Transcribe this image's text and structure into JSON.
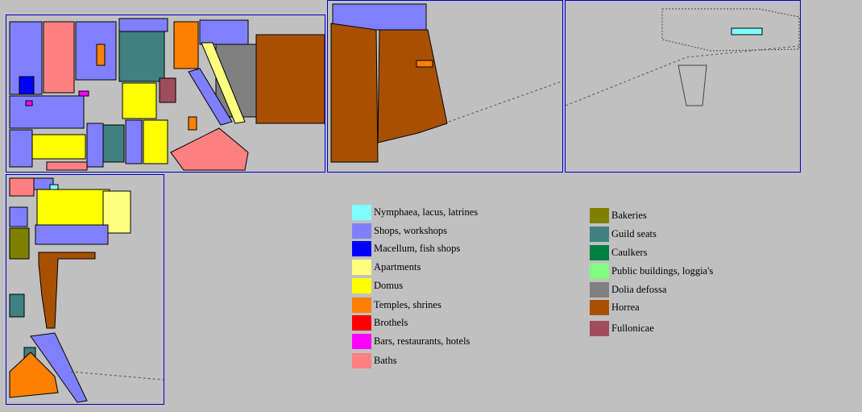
{
  "colors": {
    "nymphaea": "#80ffff",
    "shops": "#8080ff",
    "macellum": "#0000ff",
    "apartments": "#ffff80",
    "domus": "#ffff00",
    "temples": "#ff8000",
    "brothels": "#ff0000",
    "bars": "#ff00ff",
    "baths": "#ff8080",
    "bakeries": "#808000",
    "guild": "#408080",
    "caulkers": "#008040",
    "public": "#80ff80",
    "dolia": "#808080",
    "horrea": "#a85000",
    "fullonicae": "#a04c5c",
    "street": "#c0c0c0",
    "panel_border": "#0000c8"
  },
  "legend": {
    "left": [
      {
        "label": "Nymphaea, lacus, latrines",
        "color": "#80ffff"
      },
      {
        "label": "Shops, workshops",
        "color": "#8080ff"
      },
      {
        "label": "Macellum, fish shops",
        "color": "#0000ff"
      },
      {
        "label": "Apartments",
        "color": "#ffff80"
      },
      {
        "label": "Domus",
        "color": "#ffff00"
      },
      {
        "label": "Temples, shrines",
        "color": "#ff8000"
      },
      {
        "label": "Brothels",
        "color": "#ff0000"
      },
      {
        "label": "Bars, restaurants, hotels",
        "color": "#ff00ff"
      },
      {
        "label": "Baths",
        "color": "#ff8080"
      }
    ],
    "right": [
      {
        "label": "Bakeries",
        "color": "#808000"
      },
      {
        "label": "Guild seats",
        "color": "#408080"
      },
      {
        "label": "Caulkers",
        "color": "#008040"
      },
      {
        "label": "Public buildings, loggia's",
        "color": "#80ff80"
      },
      {
        "label": "Dolia defossa",
        "color": "#808080"
      },
      {
        "label": "Horrea",
        "color": "#a85000"
      },
      {
        "label": "Fullonicae",
        "color": "#a04c5c"
      }
    ]
  }
}
